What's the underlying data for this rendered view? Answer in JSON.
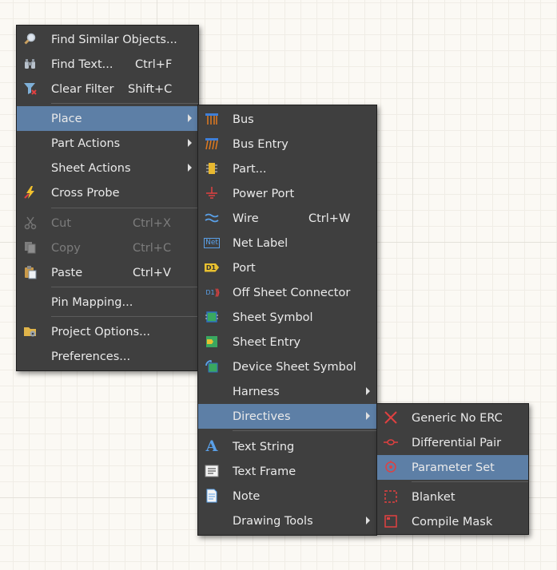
{
  "main_menu": {
    "find_similar": "Find Similar Objects...",
    "find_text": "Find Text...",
    "find_text_shortcut": "Ctrl+F",
    "clear_filter": "Clear Filter",
    "clear_filter_shortcut": "Shift+C",
    "place": "Place",
    "part_actions": "Part Actions",
    "sheet_actions": "Sheet Actions",
    "cross_probe": "Cross Probe",
    "cut": "Cut",
    "cut_shortcut": "Ctrl+X",
    "copy": "Copy",
    "copy_shortcut": "Ctrl+C",
    "paste": "Paste",
    "paste_shortcut": "Ctrl+V",
    "pin_mapping": "Pin Mapping...",
    "project_options": "Project Options...",
    "preferences": "Preferences..."
  },
  "place_menu": {
    "bus": "Bus",
    "bus_entry": "Bus Entry",
    "part": "Part...",
    "power_port": "Power Port",
    "wire": "Wire",
    "wire_shortcut": "Ctrl+W",
    "net_label": "Net Label",
    "port": "Port",
    "off_sheet_connector": "Off Sheet Connector",
    "sheet_symbol": "Sheet Symbol",
    "sheet_entry": "Sheet Entry",
    "device_sheet_symbol": "Device Sheet Symbol",
    "harness": "Harness",
    "directives": "Directives",
    "text_string": "Text String",
    "text_frame": "Text Frame",
    "note": "Note",
    "drawing_tools": "Drawing Tools",
    "net_label_icon_text": "Net",
    "port_icon_text": "D1",
    "off_sheet_icon_text": "D1",
    "text_string_icon_text": "A"
  },
  "directives_menu": {
    "generic_no_erc": "Generic No ERC",
    "differential_pair": "Differential Pair",
    "parameter_set": "Parameter Set",
    "blanket": "Blanket",
    "compile_mask": "Compile Mask"
  },
  "colors": {
    "menu_bg": "#3f3f3f",
    "highlight": "#5d7fa6",
    "text": "#eaeaea",
    "disabled_text": "#7c7c7c"
  }
}
